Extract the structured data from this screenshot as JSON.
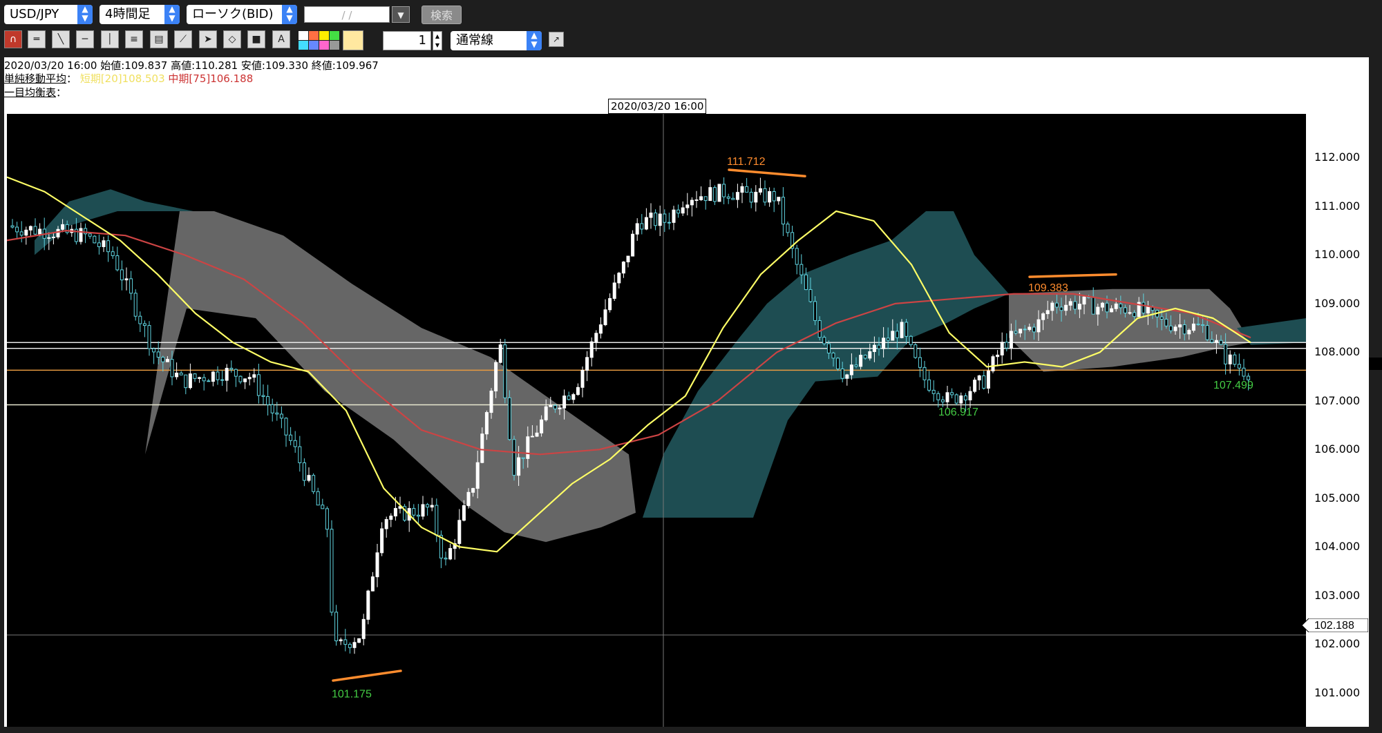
{
  "toolbar": {
    "pair": "USD/JPY",
    "timeframe": "4時間足",
    "chart_type": "ローソク(BID)",
    "date_placeholder": "/ /",
    "search_label": "検索",
    "spin_value": "1",
    "line_mode": "通常線"
  },
  "info": {
    "ohlc_line": "2020/03/20 16:00 始値:109.837 高値:110.281 安値:109.330 終値:109.967",
    "sma_label": "単純移動平均",
    "sma_short": "短期[20]108.503",
    "sma_mid": "中期[75]106.188",
    "ichimoku_label": "一目均衡表",
    "colon": "："
  },
  "cursor": {
    "time_label": "2020/03/20 16:00",
    "price_label": "102.188"
  },
  "colors": {
    "sma_short": "#ffff66",
    "sma_mid": "#cc4444",
    "cloud_teal": "#1e4d52",
    "cloud_gray": "#666666",
    "annotation": "#ff8c2e",
    "low_label": "#44cc44"
  },
  "chart_data": {
    "type": "candlestick",
    "ylim": [
      100.3,
      112.9
    ],
    "yticks": [
      "112.000",
      "111.000",
      "110.000",
      "109.000",
      "108.000",
      "107.000",
      "106.000",
      "105.000",
      "104.000",
      "103.000",
      "102.000",
      "101.000"
    ],
    "annotations": [
      {
        "label": "111.712",
        "value": 111.712
      },
      {
        "label": "101.175",
        "value": 101.175
      },
      {
        "label": "109.383",
        "value": 109.383
      },
      {
        "label": "106.917",
        "value": 106.917
      },
      {
        "label": "107.499",
        "value": 107.499
      }
    ],
    "horizontal_lines": [
      108.2,
      108.08,
      107.63,
      106.92
    ],
    "series": [
      {
        "name": "短期[20]",
        "values": [
          111.6,
          111.3,
          110.8,
          110.3,
          109.6,
          108.8,
          108.2,
          107.8,
          107.6,
          106.8,
          105.2,
          104.4,
          104.0,
          103.9,
          104.6,
          105.3,
          105.8,
          106.5,
          107.1,
          108.5,
          109.6,
          110.3,
          110.9,
          110.7,
          109.8,
          108.4,
          107.7,
          107.8,
          107.7,
          108.0,
          108.7,
          108.9,
          108.7,
          108.2
        ]
      },
      {
        "name": "中期[75]",
        "values": [
          110.3,
          110.5,
          110.4,
          110.0,
          109.5,
          108.6,
          107.4,
          106.4,
          106.0,
          105.9,
          106.0,
          106.3,
          107.0,
          108.0,
          108.6,
          109.0,
          109.1,
          109.2,
          109.2,
          109.0,
          108.8,
          108.3
        ]
      }
    ]
  }
}
